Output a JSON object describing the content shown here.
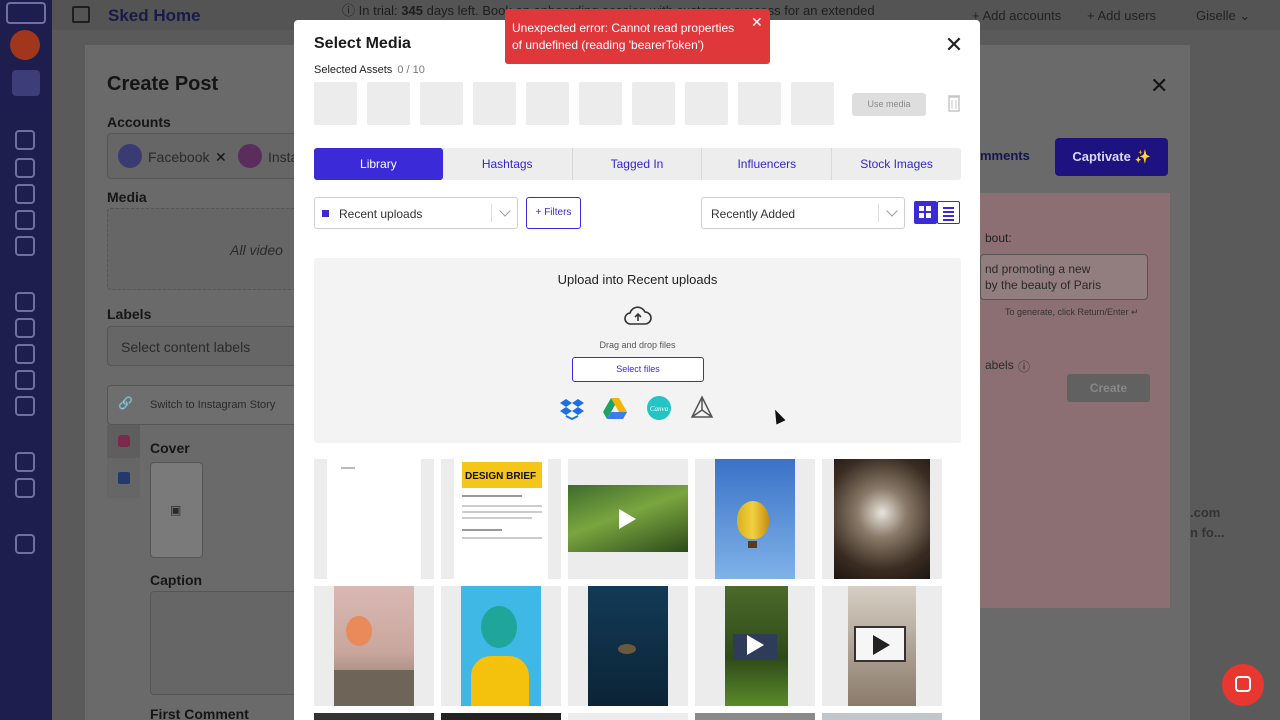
{
  "app": {
    "title": "Sked Home",
    "trial_prefix": "In trial:",
    "trial_days": "345",
    "trial_text": "days left. Book an onboarding session with customer success for an extended",
    "add_accounts": "+ Add accounts",
    "add_users": "+ Add users",
    "user": "Giselle"
  },
  "create_post": {
    "title": "Create Post",
    "accounts_label": "Accounts",
    "account_1": "Facebook",
    "account_2": "Insta",
    "media_label": "Media",
    "media_hint": "All video",
    "labels_label": "Labels",
    "labels_placeholder": "Select content labels",
    "switch_story": "Switch to Instagram Story",
    "cover_label": "Cover",
    "caption_label": "Caption",
    "first_comment_label": "First Comment",
    "comments_btn": "mments",
    "captivate_btn": "Captivate ✨",
    "about_label": "bout:",
    "about_text_1": "nd promoting a new",
    "about_text_2": "by the beauty of Paris",
    "generate_hint": "To generate, click Return/Enter ↵",
    "labels_hint": "abels",
    "create_btn": "Create",
    "side_text_1": ".com",
    "side_text_2": "n fo..."
  },
  "modal": {
    "title": "Select Media",
    "selected_assets_label": "Selected Assets",
    "selected_count": "0 / 10",
    "use_media": "Use media",
    "tabs": [
      {
        "label": "Library"
      },
      {
        "label": "Hashtags"
      },
      {
        "label": "Tagged In"
      },
      {
        "label": "Influencers"
      },
      {
        "label": "Stock Images"
      }
    ],
    "folder_value": "Recent uploads",
    "filters": "+ Filters",
    "sort_value": "Recently Added",
    "upload_title": "Upload into Recent uploads",
    "drag_text": "Drag and drop files",
    "select_files": "Select files",
    "brief_title": "DESIGN BRIEF"
  },
  "toast": {
    "message": "Unexpected error: Cannot read properties of undefined (reading 'bearerToken')"
  },
  "colors": {
    "accent": "#3a2ad8",
    "toast": "#e0373a",
    "rail": "#1d1d4e"
  }
}
